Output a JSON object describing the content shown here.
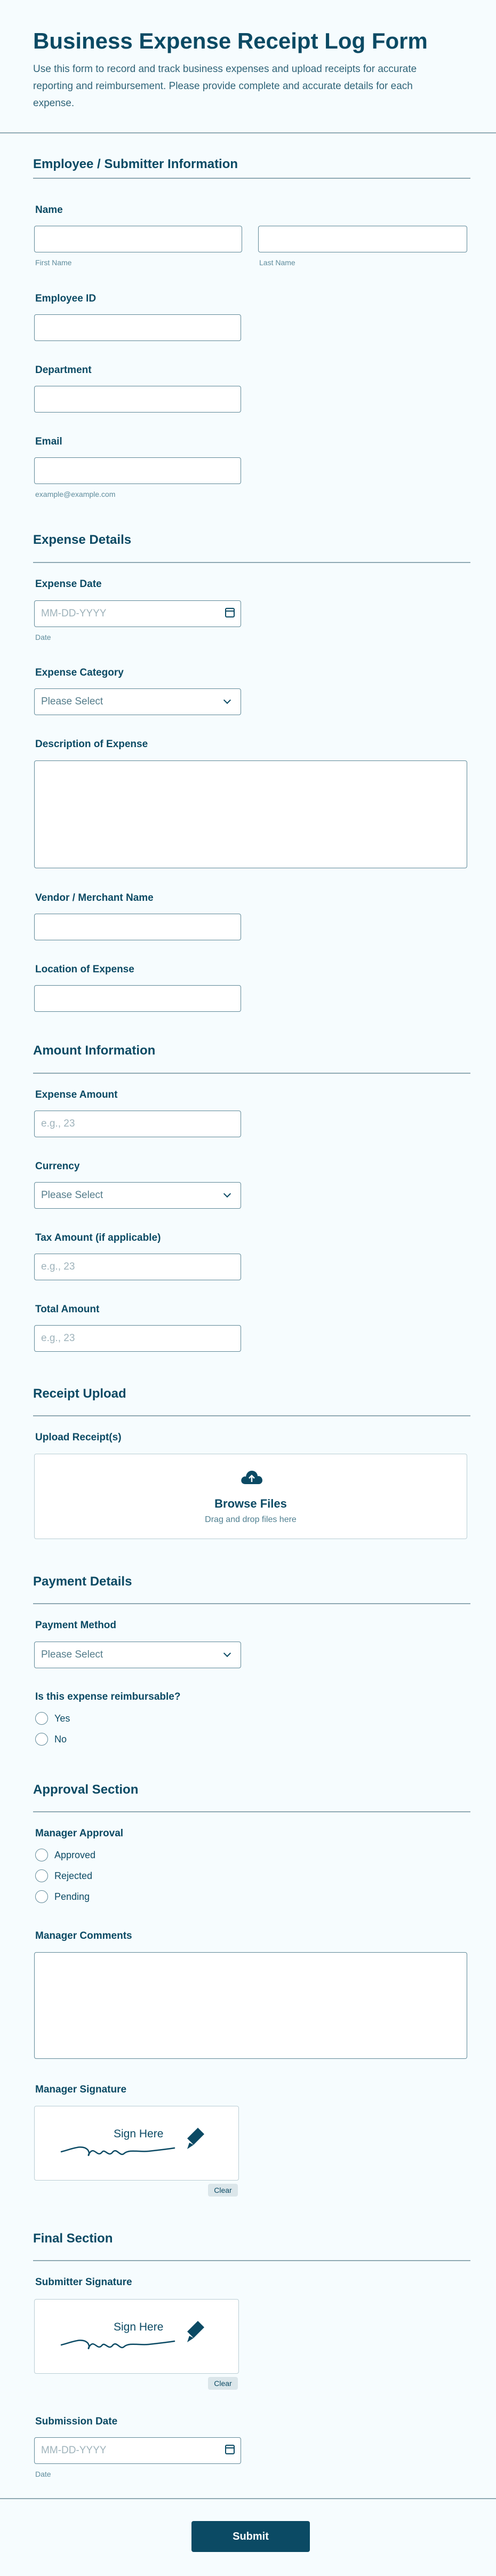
{
  "header": {
    "title": "Business Expense Receipt Log Form",
    "description": "Use this form to record and track business expenses and upload receipts for accurate reporting and reimbursement. Please provide complete and accurate details for each expense."
  },
  "sections": {
    "employee": "Employee / Submitter Information",
    "expense": "Expense Details",
    "amount": "Amount Information",
    "receipt": "Receipt Upload",
    "payment": "Payment Details",
    "approval": "Approval Section",
    "final": "Final Section"
  },
  "fields": {
    "name_label": "Name",
    "first_name_sub": "First Name",
    "last_name_sub": "Last Name",
    "employee_id_label": "Employee ID",
    "department_label": "Department",
    "email_label": "Email",
    "email_sub": "example@example.com",
    "expense_date_label": "Expense Date",
    "date_placeholder": "MM-DD-YYYY",
    "date_sub": "Date",
    "category_label": "Expense Category",
    "select_placeholder": "Please Select",
    "description_label": "Description of Expense",
    "vendor_label": "Vendor / Merchant Name",
    "location_label": "Location of Expense",
    "amount_label": "Expense Amount",
    "amount_placeholder": "e.g., 23",
    "currency_label": "Currency",
    "tax_label": "Tax Amount (if applicable)",
    "total_label": "Total Amount",
    "upload_label": "Upload Receipt(s)",
    "browse": "Browse Files",
    "drag": "Drag and drop files here",
    "payment_method_label": "Payment Method",
    "reimbursable_label": "Is this expense reimbursable?",
    "reimbursable_options": [
      "Yes",
      "No"
    ],
    "manager_approval_label": "Manager Approval",
    "approval_options": [
      "Approved",
      "Rejected",
      "Pending"
    ],
    "manager_comments_label": "Manager Comments",
    "manager_signature_label": "Manager Signature",
    "sign_here": "Sign Here",
    "clear": "Clear",
    "submitter_signature_label": "Submitter Signature",
    "submission_date_label": "Submission Date"
  },
  "submit_label": "Submit"
}
